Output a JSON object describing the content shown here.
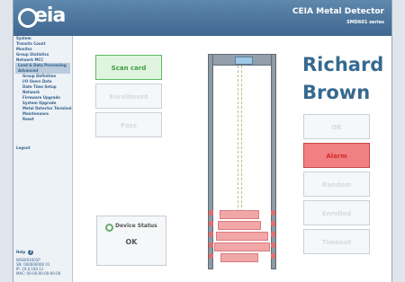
{
  "brand": {
    "logo_text": "eia",
    "title": "CEIA Metal Detector",
    "subtitle": "SMD601 series"
  },
  "menu": [
    {
      "label": "System",
      "selected": false,
      "sub": false
    },
    {
      "label": "Transits Count",
      "selected": false,
      "sub": false
    },
    {
      "label": "Monitor",
      "selected": false,
      "sub": false
    },
    {
      "label": "Group Statistics",
      "selected": false,
      "sub": false
    },
    {
      "label": "Network MCC",
      "selected": false,
      "sub": false
    },
    {
      "label": "Load & Data Processing",
      "selected": true,
      "sub": false
    },
    {
      "label": "Advanced",
      "selected": true,
      "sub": false
    },
    {
      "label": "Group Definition",
      "selected": false,
      "sub": true
    },
    {
      "label": "I/O Users Data",
      "selected": false,
      "sub": true
    },
    {
      "label": "Date Time Setup",
      "selected": false,
      "sub": true
    },
    {
      "label": "Network",
      "selected": false,
      "sub": true
    },
    {
      "label": "Firmware Upgrade",
      "selected": false,
      "sub": true
    },
    {
      "label": "System Upgrade",
      "selected": false,
      "sub": true
    },
    {
      "label": "Metal Detector Terminal",
      "selected": false,
      "sub": true
    },
    {
      "label": "Maintenance",
      "selected": false,
      "sub": true
    },
    {
      "label": "Reset",
      "selected": false,
      "sub": true
    }
  ],
  "logout_label": "Logout",
  "help_label": "Help",
  "footer_lines": [
    "WS0001001P",
    "SN: 000000000 01",
    "IP: 10.0.100.11",
    "MAC: 00-00-00-00-00-00"
  ],
  "buttons": {
    "scan": "Scan card",
    "enrollment": "Enrollment",
    "pass": "Pass",
    "ok": "OK",
    "alarm": "Alarm",
    "random": "Random",
    "enrolled": "Enrolled",
    "timeout": "Timeout"
  },
  "person": {
    "first": "Richard",
    "last": "Brown"
  },
  "device_status": {
    "title": "Device Status",
    "value": "OK"
  },
  "colors": {
    "accent": "#37698f",
    "alarm": "#f08081",
    "ok": "#5eb864"
  },
  "icons": {
    "status": "status-ok-icon",
    "help": "help-icon"
  }
}
